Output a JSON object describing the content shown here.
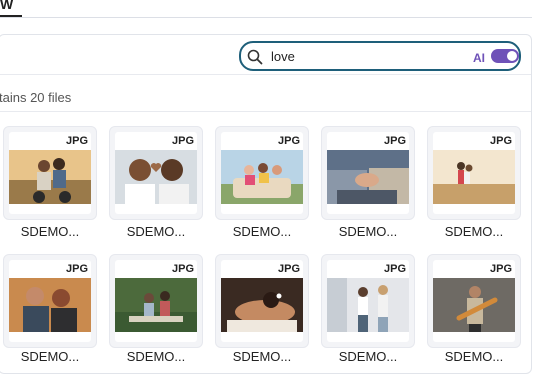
{
  "top_tab": {
    "label": "W"
  },
  "search": {
    "value": "love",
    "ai_label": "AI",
    "ai_enabled": true
  },
  "folder": {
    "count_text": "tains 20 files"
  },
  "colors": {
    "accent": "#6f52b8",
    "search_border": "#1e5f7a"
  },
  "files": [
    {
      "name": "SDEMO...",
      "type": "JPG",
      "thumb": "couple-motorbike"
    },
    {
      "name": "SDEMO...",
      "type": "JPG",
      "thumb": "heart-hands"
    },
    {
      "name": "SDEMO...",
      "type": "JPG",
      "thumb": "friends-car"
    },
    {
      "name": "SDEMO...",
      "type": "JPG",
      "thumb": "holding-hands"
    },
    {
      "name": "SDEMO...",
      "type": "JPG",
      "thumb": "couple-field"
    },
    {
      "name": "SDEMO...",
      "type": "JPG",
      "thumb": "couple-laughing"
    },
    {
      "name": "SDEMO...",
      "type": "JPG",
      "thumb": "couple-picnic"
    },
    {
      "name": "SDEMO...",
      "type": "JPG",
      "thumb": "woman-massage"
    },
    {
      "name": "SDEMO...",
      "type": "JPG",
      "thumb": "couple-dancing"
    },
    {
      "name": "SDEMO...",
      "type": "JPG",
      "thumb": "man-guitar"
    }
  ]
}
